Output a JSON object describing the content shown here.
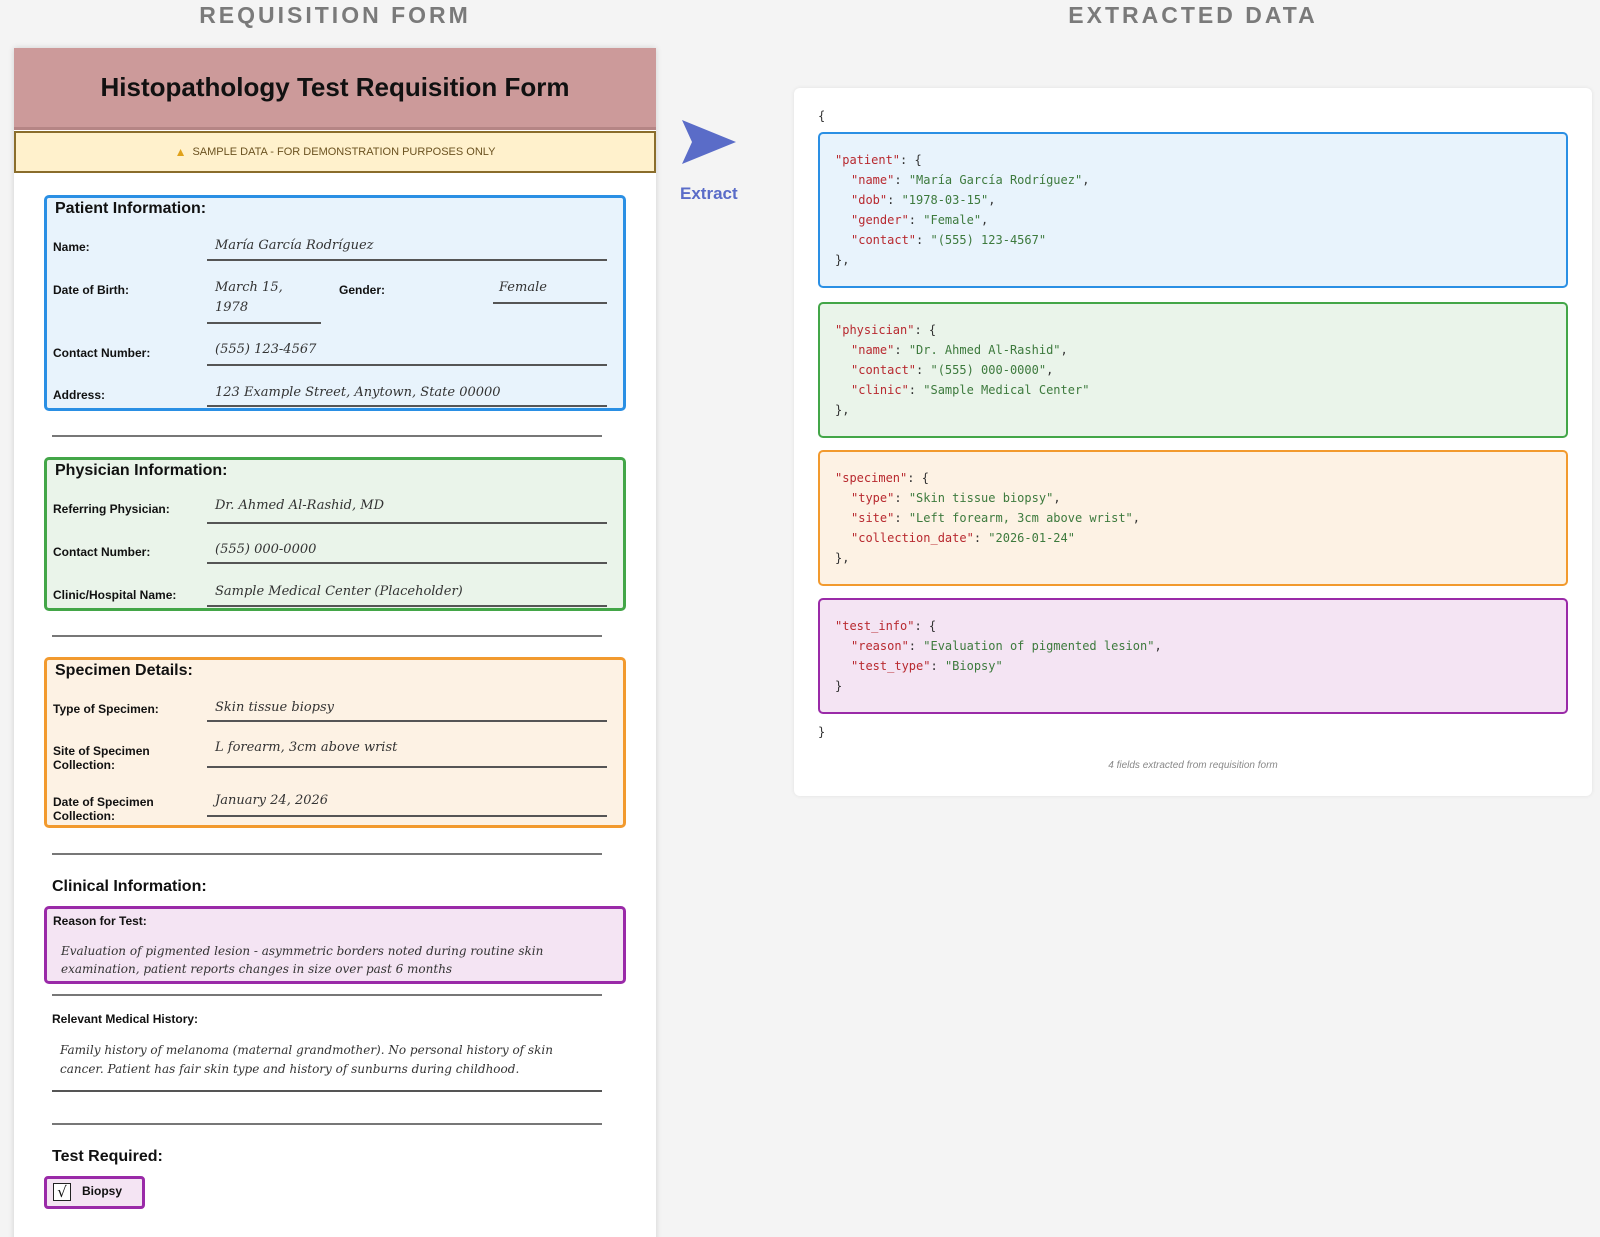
{
  "titles": {
    "left": "REQUISITION FORM",
    "right": "EXTRACTED DATA"
  },
  "form": {
    "title": "Histopathology Test Requisition Form",
    "banner": "SAMPLE DATA - FOR DEMONSTRATION PURPOSES ONLY",
    "patient": {
      "section": "Patient Information:",
      "name_label": "Name:",
      "name": "María García Rodríguez",
      "dob_label": "Date of Birth:",
      "dob_line1": "March 15,",
      "dob_line2": "1978",
      "gender_label": "Gender:",
      "gender": "Female",
      "contact_label": "Contact Number:",
      "contact": "(555) 123-4567",
      "address_label": "Address:",
      "address": "123 Example Street, Anytown, State 00000"
    },
    "physician": {
      "section": "Physician Information:",
      "ref_label": "Referring Physician:",
      "ref": "Dr. Ahmed Al-Rashid, MD",
      "contact_label": "Contact Number:",
      "contact": "(555) 000-0000",
      "clinic_label": "Clinic/Hospital Name:",
      "clinic": "Sample Medical Center (Placeholder)"
    },
    "specimen": {
      "section": "Specimen Details:",
      "type_label": "Type of Specimen:",
      "type": "Skin tissue biopsy",
      "site_label_1": "Site of Specimen",
      "site_label_2": "Collection:",
      "site": "L forearm, 3cm above wrist",
      "date_label_1": "Date of Specimen",
      "date_label_2": "Collection:",
      "date": "January 24, 2026"
    },
    "clinical": {
      "section": "Clinical Information:",
      "reason_label": "Reason for Test:",
      "reason_1": "Evaluation of pigmented lesion - asymmetric borders noted during routine skin",
      "reason_2": "examination, patient reports changes in size over past 6 months",
      "history_label": "Relevant Medical History:",
      "history_1": "Family history of melanoma (maternal grandmother). No personal history of skin",
      "history_2": "cancer. Patient has fair skin type and history of sunburns during childhood."
    },
    "test": {
      "section": "Test Required:",
      "check_mark": "√",
      "option": "Biopsy",
      "checked": true
    }
  },
  "arrow": {
    "label": "Extract",
    "color": "#5a6cc8"
  },
  "json_view": {
    "open": "{",
    "close": "}",
    "patient": {
      "key": "\"patient\"",
      "open": ": {",
      "close": "},",
      "rows": [
        {
          "k": "\"name\"",
          "v": "\"María García Rodríguez\"",
          "end": ","
        },
        {
          "k": "\"dob\"",
          "v": "\"1978-03-15\"",
          "end": ","
        },
        {
          "k": "\"gender\"",
          "v": "\"Female\"",
          "end": ","
        },
        {
          "k": "\"contact\"",
          "v": "\"(555) 123-4567\"",
          "end": ""
        }
      ]
    },
    "physician": {
      "key": "\"physician\"",
      "open": ": {",
      "close": "},",
      "rows": [
        {
          "k": "\"name\"",
          "v": "\"Dr. Ahmed Al-Rashid\"",
          "end": ","
        },
        {
          "k": "\"contact\"",
          "v": "\"(555) 000-0000\"",
          "end": ","
        },
        {
          "k": "\"clinic\"",
          "v": "\"Sample Medical Center\"",
          "end": ""
        }
      ]
    },
    "specimen": {
      "key": "\"specimen\"",
      "open": ": {",
      "close": "},",
      "rows": [
        {
          "k": "\"type\"",
          "v": "\"Skin tissue biopsy\"",
          "end": ","
        },
        {
          "k": "\"site\"",
          "v": "\"Left forearm, 3cm above wrist\"",
          "end": ","
        },
        {
          "k": "\"collection_date\"",
          "v": "\"2026-01-24\"",
          "end": ""
        }
      ]
    },
    "test_info": {
      "key": "\"test_info\"",
      "open": ": {",
      "close": "}",
      "rows": [
        {
          "k": "\"reason\"",
          "v": "\"Evaluation of pigmented lesion\"",
          "end": ","
        },
        {
          "k": "\"test_type\"",
          "v": "\"Biopsy\"",
          "end": ""
        }
      ]
    },
    "footnote": "4 fields extracted from requisition form"
  },
  "colors": {
    "patient": "#2a8fe4",
    "physician": "#43a648",
    "specimen": "#f29a2e",
    "clinical": "#9a2aa8",
    "header": "#cc9a9a"
  }
}
